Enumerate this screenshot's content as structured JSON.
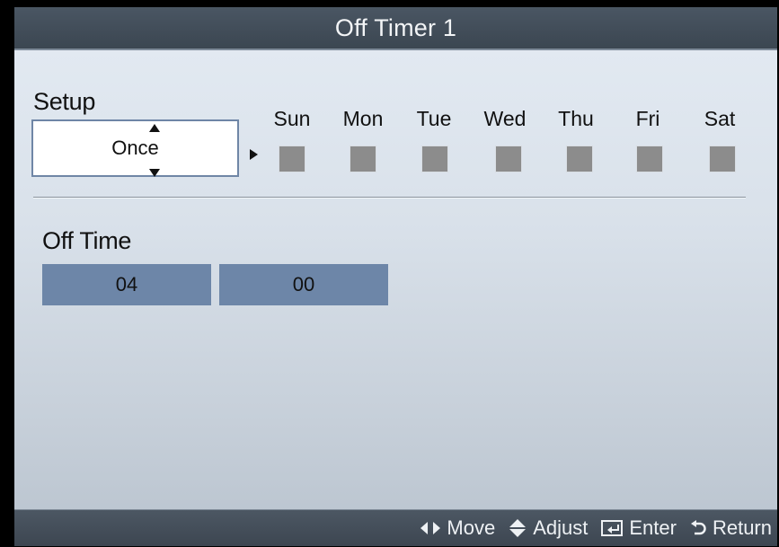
{
  "title": "Off Timer 1",
  "setup": {
    "label": "Setup",
    "value": "Once"
  },
  "days": [
    {
      "label": "Sun",
      "checked": false
    },
    {
      "label": "Mon",
      "checked": false
    },
    {
      "label": "Tue",
      "checked": false
    },
    {
      "label": "Wed",
      "checked": false
    },
    {
      "label": "Thu",
      "checked": false
    },
    {
      "label": "Fri",
      "checked": false
    },
    {
      "label": "Sat",
      "checked": false
    }
  ],
  "off_time": {
    "label": "Off Time",
    "hour": "04",
    "minute": "00"
  },
  "footer": {
    "move": "Move",
    "adjust": "Adjust",
    "enter": "Enter",
    "return": "Return"
  },
  "colors": {
    "title_bar": "#3f4a56",
    "panel": "#dde4ec",
    "time_field": "#6d86a8",
    "select_border": "#6f86a6",
    "checkbox": "#8c8c8c"
  }
}
